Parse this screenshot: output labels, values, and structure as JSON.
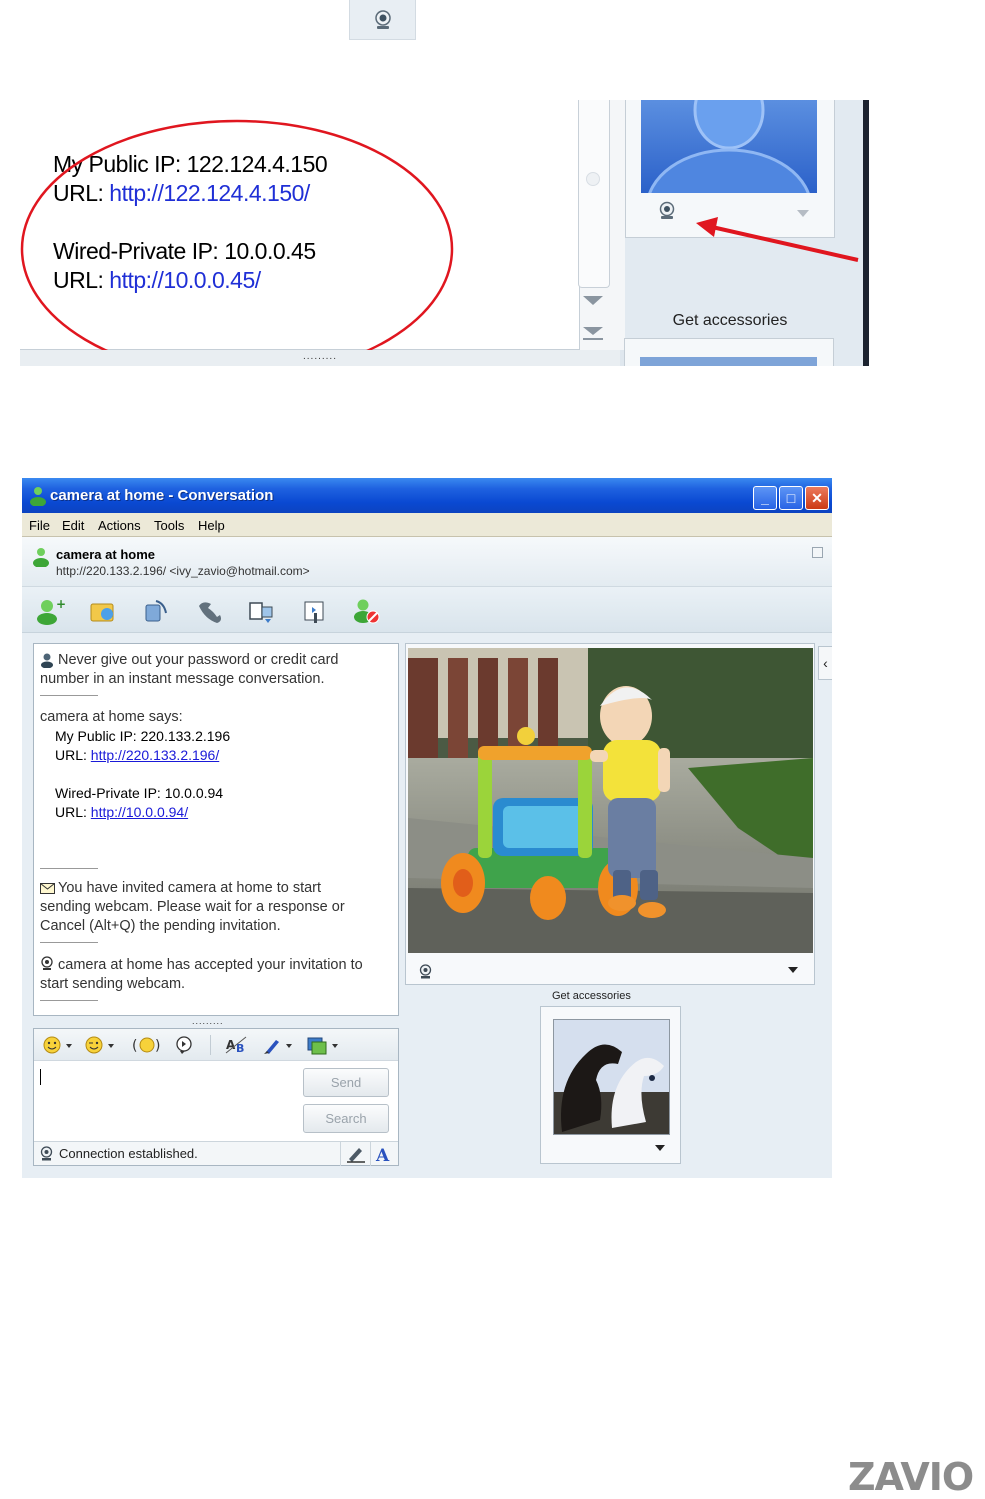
{
  "zoom": {
    "public_ip_line": "My Public IP: 122.124.4.150",
    "public_url_prefix": "URL: ",
    "public_url": "http://122.124.4.150/",
    "private_ip_line": "Wired-Private IP: 10.0.0.45",
    "private_url_prefix": "URL: ",
    "private_url": "http://10.0.0.45/",
    "splitter": ".........",
    "get_accessories": "Get accessories",
    "highlight_color": "#e0161f",
    "arrow_color": "#e0161f"
  },
  "window": {
    "title": "camera at home - Conversation",
    "minimize": "_",
    "maximize": "□",
    "close": "✕",
    "menu": [
      "File",
      "Edit",
      "Actions",
      "Tools",
      "Help"
    ],
    "contact_name": "camera at home",
    "contact_address": "http://220.133.2.196/ <ivy_zavio@hotmail.com>",
    "toolbar_icons": [
      "invite-contact-icon",
      "send-files-icon",
      "video-call-icon",
      "call-icon",
      "activities-icon",
      "games-icon",
      "block-icon"
    ]
  },
  "chat": {
    "warning_1": "Never give out your password or credit card",
    "warning_2": "number in an instant message conversation.",
    "says": "camera at home says:",
    "public_ip": "My Public IP: 220.133.2.196",
    "url_prefix_1": "URL: ",
    "public_url": "http://220.133.2.196/",
    "private_ip": "Wired-Private IP: 10.0.0.94",
    "url_prefix_2": "URL: ",
    "private_url": "http://10.0.0.94/",
    "invite_1": "You have invited camera at home to start",
    "invite_2": "sending webcam. Please wait for a response or",
    "invite_3": "Cancel (Alt+Q) the pending invitation.",
    "accepted_1": "camera at home has accepted your invitation to",
    "accepted_2": "start sending webcam."
  },
  "input": {
    "splitter": ".........",
    "send_label": "Send",
    "search_label": "Search",
    "status_text": "Connection established."
  },
  "webcam": {
    "get_accessories": "Get accessories"
  },
  "brand": {
    "logo": "ZAVIO"
  }
}
